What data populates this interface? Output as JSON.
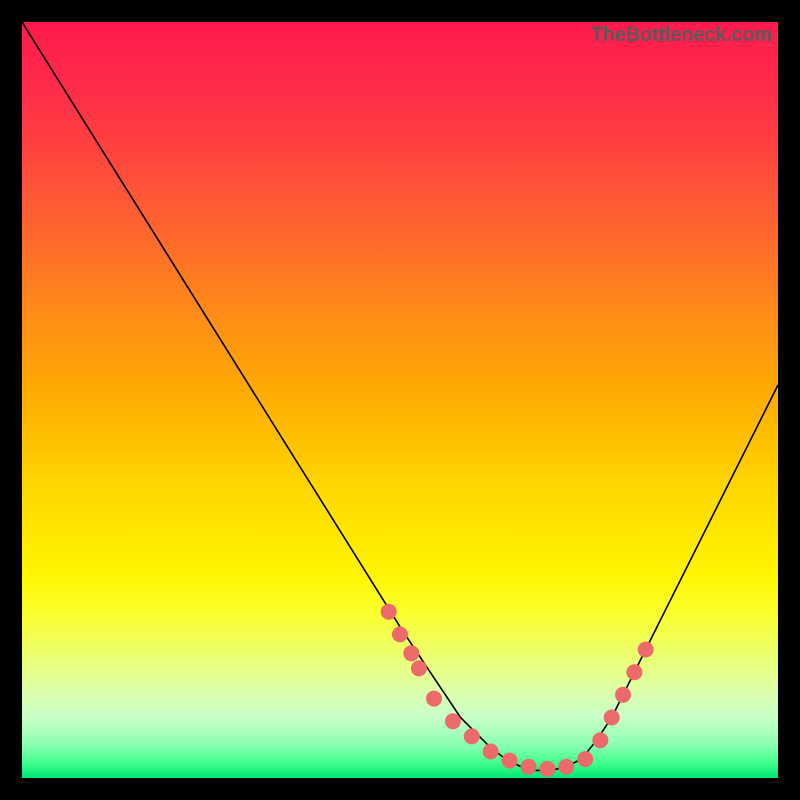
{
  "attribution": "TheBottleneck.com",
  "chart_data": {
    "type": "line",
    "title": "",
    "xlabel": "",
    "ylabel": "",
    "xlim": [
      0,
      100
    ],
    "ylim": [
      0,
      100
    ],
    "series": [
      {
        "name": "bottleneck-curve",
        "x": [
          0,
          5,
          10,
          15,
          20,
          25,
          30,
          35,
          40,
          45,
          50,
          52,
          54,
          56,
          58,
          60,
          62,
          64,
          66,
          68,
          70,
          72,
          74,
          76,
          78,
          80,
          85,
          90,
          95,
          100
        ],
        "y": [
          100,
          92,
          84,
          76,
          68,
          60,
          52,
          44,
          36,
          28,
          20,
          17,
          14,
          11,
          8,
          6,
          4,
          2.5,
          1.5,
          1,
          1,
          1.5,
          2.5,
          5,
          8,
          12,
          22,
          32,
          42,
          52
        ]
      }
    ],
    "marker_points": {
      "name": "highlight-dots",
      "x": [
        48.5,
        50,
        51.5,
        52.5,
        54.5,
        57,
        59.5,
        62,
        64.5,
        67,
        69.5,
        72,
        74.5,
        76.5,
        78,
        79.5,
        81,
        82.5
      ],
      "y": [
        22,
        19,
        16.5,
        14.5,
        10.5,
        7.5,
        5.5,
        3.5,
        2.3,
        1.5,
        1.2,
        1.5,
        2.5,
        5,
        8,
        11,
        14,
        17
      ]
    },
    "background_gradient": {
      "top": "#ff1a4d",
      "mid": "#ffd800",
      "bottom": "#00e676"
    }
  }
}
